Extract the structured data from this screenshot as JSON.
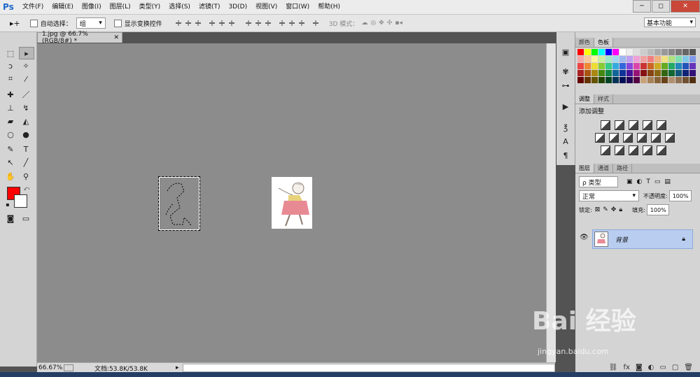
{
  "app": {
    "logo": "Ps"
  },
  "menu": [
    "文件(F)",
    "编辑(E)",
    "图像(I)",
    "图层(L)",
    "类型(Y)",
    "选择(S)",
    "滤镜(T)",
    "3D(D)",
    "视图(V)",
    "窗口(W)",
    "帮助(H)"
  ],
  "window_buttons": {
    "minimize": "─",
    "restore": "◻",
    "close": "✕"
  },
  "options": {
    "auto_select_label": "自动选择：",
    "auto_select_value": "组",
    "show_transform_label": "显示变换控件",
    "mode_3d_label": "3D 模式：",
    "workspace": "基本功能"
  },
  "document": {
    "tab_title": "1.jpg @ 66.7%(RGB/8#) *"
  },
  "status": {
    "zoom": "66.67%",
    "doc_info": "文档:53.8K/53.8K"
  },
  "panels": {
    "color_tabs": [
      "颜色",
      "色板"
    ],
    "adjust_tabs": [
      "调整",
      "样式"
    ],
    "adjust_title": "添加调整",
    "layers_tabs": [
      "图层",
      "通道",
      "路径"
    ],
    "layer_filter": "ρ 类型",
    "blend_mode": "正常",
    "opacity_label": "不透明度:",
    "opacity_value": "100%",
    "lock_label": "锁定:",
    "fill_label": "填充:",
    "fill_value": "100%",
    "layer_name": "背景"
  },
  "watermark": {
    "text": "Bai 经验",
    "url": "jingyan.baidu.com"
  },
  "colors": {
    "fg": "#ff0000",
    "bg": "#ffffff",
    "layer_selected": "#b8cdf0"
  },
  "swatch_colors": [
    "#ff0000",
    "#ffff00",
    "#00ff00",
    "#00ffff",
    "#0000ff",
    "#ff00ff",
    "#ffffff",
    "#eeeeee",
    "#dddddd",
    "#cccccc",
    "#bbbbbb",
    "#aaaaaa",
    "#999999",
    "#888888",
    "#777777",
    "#666666",
    "#555555",
    "#f4a9a9",
    "#f9c99b",
    "#fff3a0",
    "#c9f0a0",
    "#a0e8c9",
    "#a0d8f0",
    "#a0b8f0",
    "#c0a0f0",
    "#f0a0d8",
    "#f0a0a0",
    "#f08080",
    "#f0b080",
    "#f0e080",
    "#b0e080",
    "#80e0b0",
    "#80c8e8",
    "#8098e8",
    "#ee4444",
    "#ee8833",
    "#eedd33",
    "#88cc33",
    "#33cc88",
    "#33aadd",
    "#3366dd",
    "#8844dd",
    "#dd44aa",
    "#cc3333",
    "#cc6622",
    "#ccaa22",
    "#66aa22",
    "#22aa66",
    "#2288bb",
    "#2255bb",
    "#6633bb",
    "#aa2222",
    "#aa5511",
    "#aa8811",
    "#448811",
    "#118844",
    "#116699",
    "#113399",
    "#441199",
    "#991177",
    "#881111",
    "#884411",
    "#886611",
    "#336611",
    "#116633",
    "#115577",
    "#112277",
    "#331177",
    "#660000",
    "#663300",
    "#665500",
    "#224400",
    "#004422",
    "#003355",
    "#001155",
    "#220055",
    "#550044",
    "#c8a27a",
    "#a88258",
    "#886238",
    "#684218",
    "#b09070",
    "#907050",
    "#705030",
    "#503010"
  ]
}
